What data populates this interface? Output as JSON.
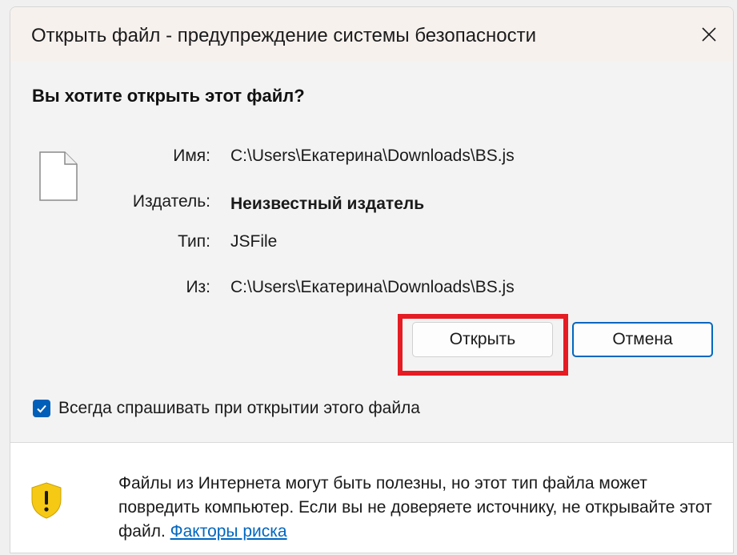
{
  "window": {
    "title": "Открыть файл - предупреждение системы безопасности",
    "close_glyph": "✕"
  },
  "question": "Вы хотите открыть этот файл?",
  "file": {
    "icon": "document-icon",
    "name_label": "Имя:",
    "name_value": "C:\\Users\\Екатерина\\Downloads\\BS.js",
    "publisher_label": "Издатель:",
    "publisher_value": "Неизвестный издатель",
    "type_label": "Тип:",
    "type_value": "JSFile",
    "from_label": "Из:",
    "from_value": "C:\\Users\\Екатерина\\Downloads\\BS.js"
  },
  "buttons": {
    "open_label": "Открыть",
    "cancel_label": "Отмена"
  },
  "checkbox": {
    "label": "Всегда спрашивать при открытии этого файла",
    "checked": true
  },
  "warning": {
    "icon": "shield-warning-icon",
    "text": "Файлы из Интернета могут быть полезны, но этот тип файла может повредить компьютер. Если вы не доверяете источнику, не открывайте этот файл.",
    "link_text": "Факторы риска"
  },
  "colors": {
    "accent": "#0067c0",
    "highlight": "#e51c23",
    "shield": "#f6c915"
  }
}
